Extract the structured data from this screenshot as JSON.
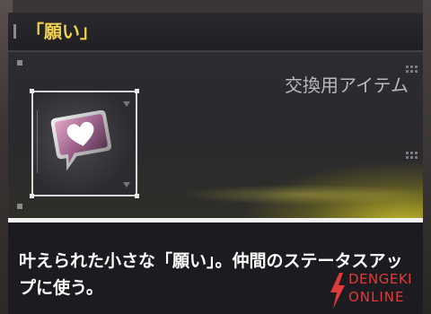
{
  "header": {
    "title": "「願い」"
  },
  "item": {
    "category": "交換用アイテム",
    "icon": "heart-speech-bubble-icon",
    "description": "叶えられた小さな「願い」。仲間のステータスアップに使う。"
  },
  "watermark": {
    "line1": "DENGEKI",
    "line2": "ONLINE"
  },
  "colors": {
    "title": "#f0d34a",
    "glow": "#d2c828",
    "watermark": "#e03a3a"
  }
}
